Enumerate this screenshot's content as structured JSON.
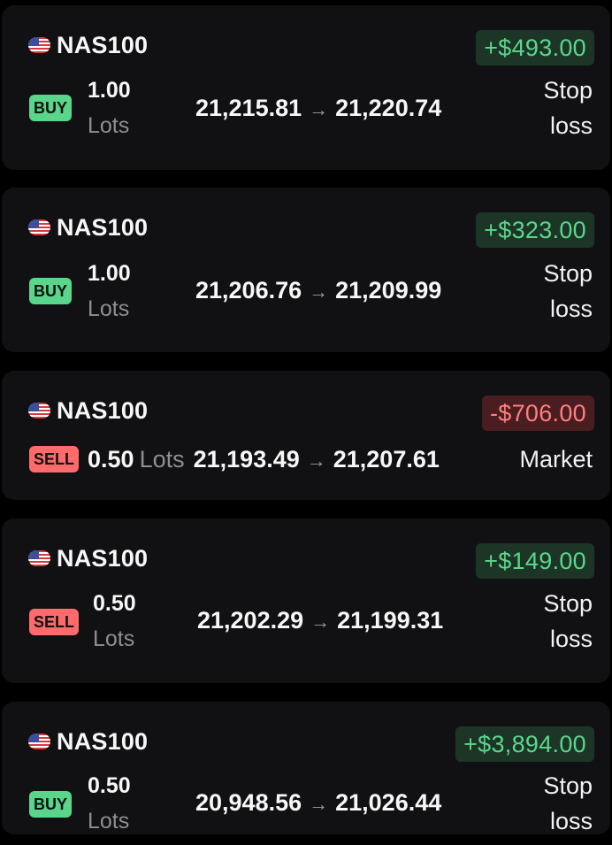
{
  "positions": [
    {
      "symbol": "NAS100",
      "flag_icon": "us-flag-icon",
      "pnl": "+$493.00",
      "pnl_status": "positive",
      "side": "BUY",
      "lots_value": "1.00",
      "lots_unit": "Lots",
      "open_price": "21,215.81",
      "arrow": "→",
      "current_price": "21,220.74",
      "close_type_line1": "Stop",
      "close_type_line2": "loss"
    },
    {
      "symbol": "NAS100",
      "flag_icon": "us-flag-icon",
      "pnl": "+$323.00",
      "pnl_status": "positive",
      "side": "BUY",
      "lots_value": "1.00",
      "lots_unit": "Lots",
      "open_price": "21,206.76",
      "arrow": "→",
      "current_price": "21,209.99",
      "close_type_line1": "Stop",
      "close_type_line2": "loss"
    },
    {
      "symbol": "NAS100",
      "flag_icon": "us-flag-icon",
      "pnl": "-$706.00",
      "pnl_status": "negative",
      "side": "SELL",
      "lots_value": "0.50",
      "lots_unit": "Lots",
      "open_price": "21,193.49",
      "arrow": "→",
      "current_price": "21,207.61",
      "close_type": "Market"
    },
    {
      "symbol": "NAS100",
      "flag_icon": "us-flag-icon",
      "pnl": "+$149.00",
      "pnl_status": "positive",
      "side": "SELL",
      "lots_value": "0.50",
      "lots_unit": "Lots",
      "open_price": "21,202.29",
      "arrow": "→",
      "current_price": "21,199.31",
      "close_type_line1": "Stop",
      "close_type_line2": "loss"
    },
    {
      "symbol": "NAS100",
      "flag_icon": "us-flag-icon",
      "pnl": "+$3,894.00",
      "pnl_status": "positive",
      "side": "BUY",
      "lots_value": "0.50",
      "lots_unit": "Lots",
      "open_price": "20,948.56",
      "arrow": "→",
      "current_price": "21,026.44",
      "close_type_line1": "Stop",
      "close_type_line2": "loss"
    }
  ],
  "colors": {
    "background": "#000000",
    "card": "#111114",
    "buy": "#59d68b",
    "sell": "#ff6b6b",
    "profit_text": "#5ad78a",
    "profit_bg": "#1c3527",
    "loss_text": "#ff7f7f",
    "loss_bg": "#4a1e21",
    "muted": "#8e8e93"
  }
}
